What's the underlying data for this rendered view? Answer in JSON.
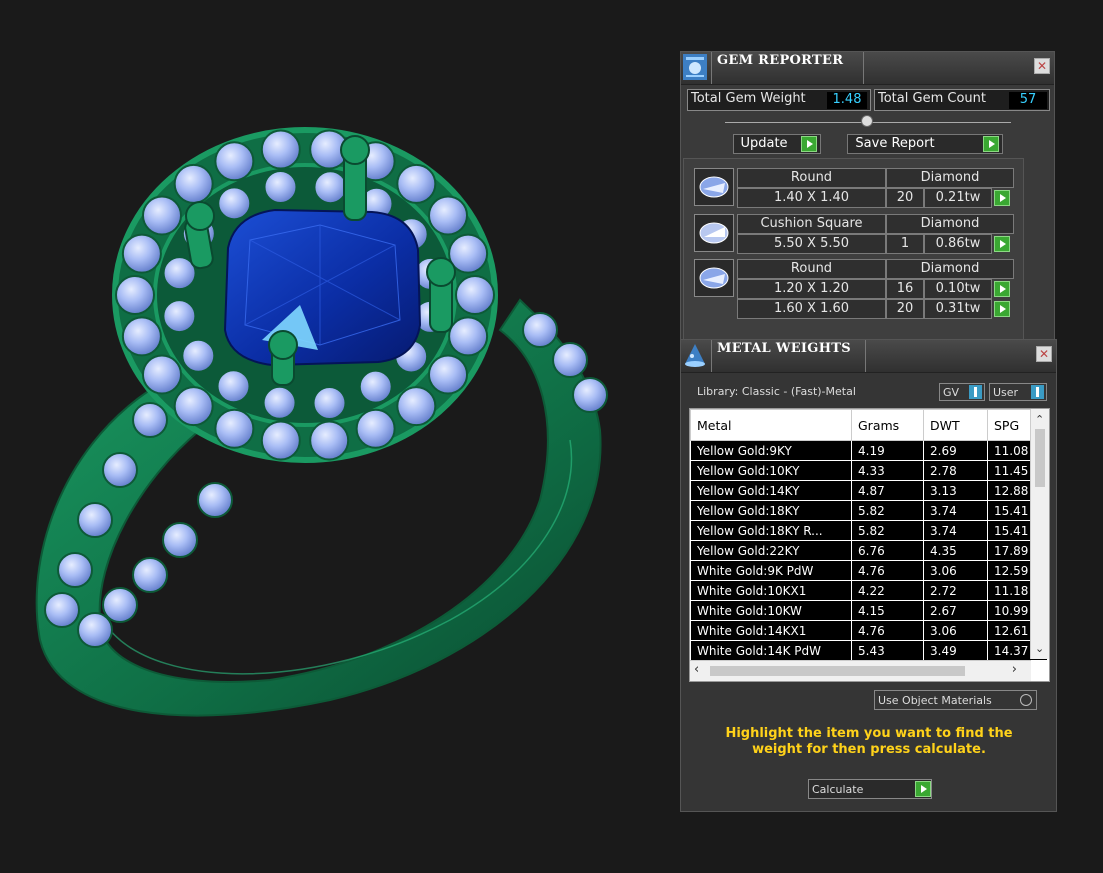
{
  "gem_reporter": {
    "title": "GEM REPORTER",
    "close": "✕",
    "total_weight_label": "Total Gem Weight",
    "total_weight_value": "1.48",
    "total_count_label": "Total Gem Count",
    "total_count_value": "57",
    "update_label": "Update",
    "save_report_label": "Save Report",
    "groups": [
      {
        "shape": "Round",
        "type": "Diamond",
        "rows": [
          {
            "size": "1.40 X 1.40",
            "count": "20",
            "weight": "0.21tw"
          }
        ]
      },
      {
        "shape": "Cushion Square",
        "type": "Diamond",
        "rows": [
          {
            "size": "5.50 X 5.50",
            "count": "1",
            "weight": "0.86tw"
          }
        ]
      },
      {
        "shape": "Round",
        "type": "Diamond",
        "rows": [
          {
            "size": "1.20 X 1.20",
            "count": "16",
            "weight": "0.10tw"
          },
          {
            "size": "1.60 X 1.60",
            "count": "20",
            "weight": "0.31tw"
          }
        ]
      }
    ]
  },
  "metal_weights": {
    "title": "METAL WEIGHTS",
    "close": "✕",
    "library_label": "Library: Classic - (Fast)-Metal",
    "gv_label": "GV",
    "user_label": "User",
    "columns": [
      "Metal",
      "Grams",
      "DWT",
      "SPG"
    ],
    "rows": [
      [
        "Yellow Gold:9KY",
        "4.19",
        "2.69",
        "11.08"
      ],
      [
        "Yellow Gold:10KY",
        "4.33",
        "2.78",
        "11.45"
      ],
      [
        "Yellow Gold:14KY",
        "4.87",
        "3.13",
        "12.88"
      ],
      [
        "Yellow Gold:18KY",
        "5.82",
        "3.74",
        "15.41"
      ],
      [
        "Yellow Gold:18KY R...",
        "5.82",
        "3.74",
        "15.41"
      ],
      [
        "Yellow Gold:22KY",
        "6.76",
        "4.35",
        "17.89"
      ],
      [
        "White Gold:9K PdW",
        "4.76",
        "3.06",
        "12.59"
      ],
      [
        "White Gold:10KX1",
        "4.22",
        "2.72",
        "11.18"
      ],
      [
        "White Gold:10KW",
        "4.15",
        "2.67",
        "10.99"
      ],
      [
        "White Gold:14KX1",
        "4.76",
        "3.06",
        "12.61"
      ],
      [
        "White Gold:14K PdW",
        "5.43",
        "3.49",
        "14.37"
      ]
    ],
    "use_object_materials_label": "Use Object Materials",
    "instruction": "Highlight the item you want to find the weight for then press calculate.",
    "calculate_label": "Calculate"
  },
  "colors": {
    "accent_cyan": "#37d0ff",
    "play_green": "#3aa832",
    "instruction_yellow": "#ffd21a",
    "ring_green": "#137a4e",
    "gem_blue": "#0a2fa8",
    "stone_lavender": "#a9bdf5"
  }
}
